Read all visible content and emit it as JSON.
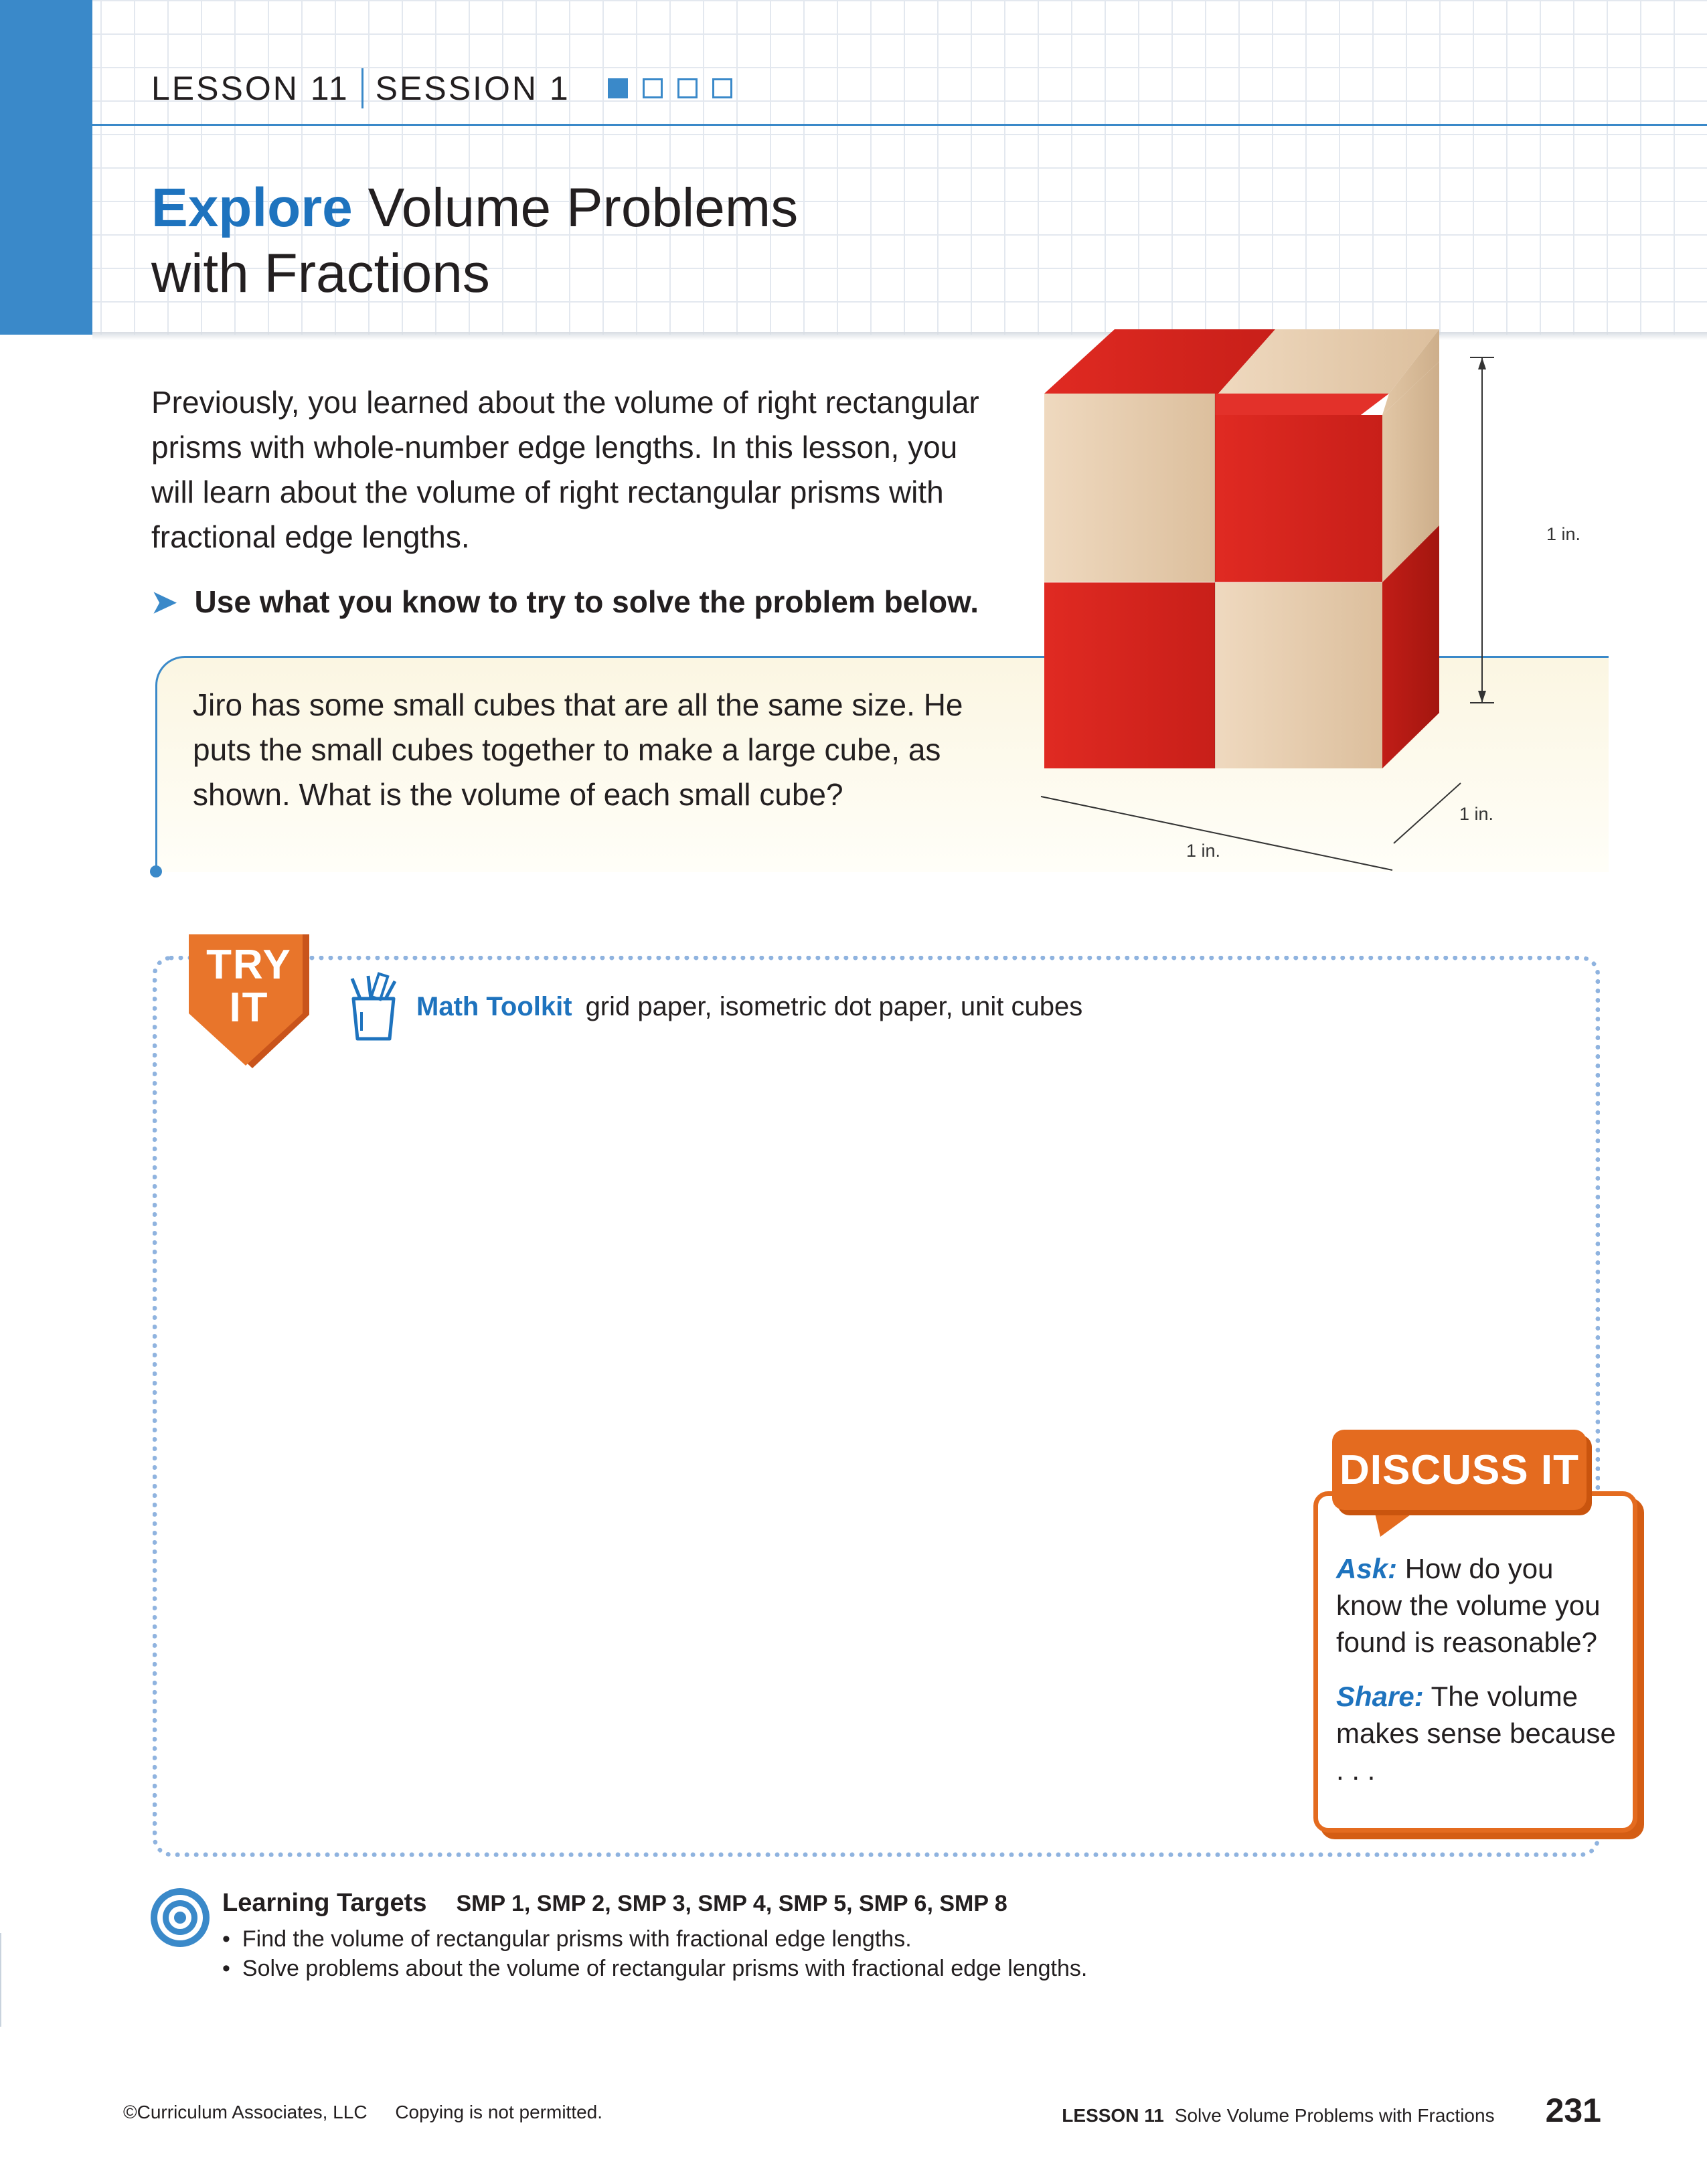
{
  "header": {
    "lesson": "LESSON 11",
    "session": "SESSION 1",
    "progress": {
      "completed": 1,
      "total": 4
    },
    "title_strong": "Explore",
    "title_line1": " Volume Problems",
    "title_line2": "with Fractions"
  },
  "intro": {
    "paragraph": "Previously, you learned about the volume of right rectangular prisms with whole-number edge lengths. In this lesson, you will learn about the volume of right rectangular prisms with fractional edge lengths.",
    "prompt": "Use what you know to try to solve the problem below."
  },
  "problem": {
    "text": "Jiro has some small cubes that are all the same size. He puts the small cubes together to make a large cube, as shown. What is the volume of each small cube?"
  },
  "figure": {
    "height_label": "1 in.",
    "depth_label": "1 in.",
    "width_label": "1 in.",
    "colors": {
      "red": "#d8261f",
      "wood": "#e8cdb0"
    }
  },
  "try_it": {
    "badge_line1": "TRY",
    "badge_line2": "IT",
    "toolkit_label": "Math Toolkit",
    "toolkit_items": "grid paper, isometric dot paper, unit cubes"
  },
  "discuss_it": {
    "title": "DISCUSS IT",
    "ask_label": "Ask:",
    "ask_text": " How do you know the volume you found is reasonable?",
    "share_label": "Share:",
    "share_text": " The volume makes sense because . . ."
  },
  "learning_targets": {
    "title": "Learning Targets",
    "smp": "SMP 1, SMP 2, SMP 3, SMP 4, SMP 5, SMP 6, SMP 8",
    "items": [
      "Find the volume of rectangular prisms with fractional edge lengths.",
      "Solve problems about the volume of rectangular prisms with fractional edge lengths."
    ]
  },
  "footer": {
    "copyright": "©Curriculum Associates, LLC",
    "notice": "Copying is not permitted.",
    "lesson": "LESSON 11",
    "lesson_title": "Solve Volume Problems with Fractions",
    "page_number": "231"
  }
}
